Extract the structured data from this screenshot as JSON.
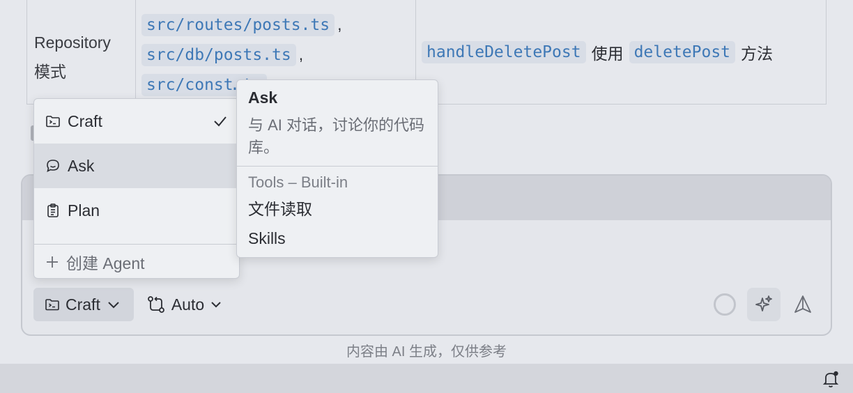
{
  "table": {
    "col1_line1": "Repository",
    "col1_line2": "模式",
    "code_items": [
      "src/routes/posts.ts",
      "src/db/posts.ts",
      "src/const…ts"
    ],
    "sep": ",",
    "col3_code1": "handleDeletePost",
    "col3_text1": "使用",
    "col3_code2": "deletePost",
    "col3_text2": "方法"
  },
  "menu": {
    "items": [
      {
        "label": "Craft",
        "icon": "terminal-folder-icon",
        "selected": true
      },
      {
        "label": "Ask",
        "icon": "chat-bubble-icon",
        "selected": false
      },
      {
        "label": "Plan",
        "icon": "clipboard-icon",
        "selected": false
      }
    ],
    "create_label": "创建 Agent"
  },
  "tooltip": {
    "title": "Ask",
    "description": "与 AI 对话，讨论你的代码库。",
    "section_label": "Tools – Built-in",
    "tools": [
      "文件读取",
      "Skills"
    ]
  },
  "composer": {
    "mode_label": "Craft",
    "model_label": "Auto"
  },
  "disclaimer": "内容由 AI 生成，仅供参考",
  "colors": {
    "code_text": "#3e78b6",
    "code_bg": "#d8dde6",
    "background": "#e6e8ed"
  }
}
